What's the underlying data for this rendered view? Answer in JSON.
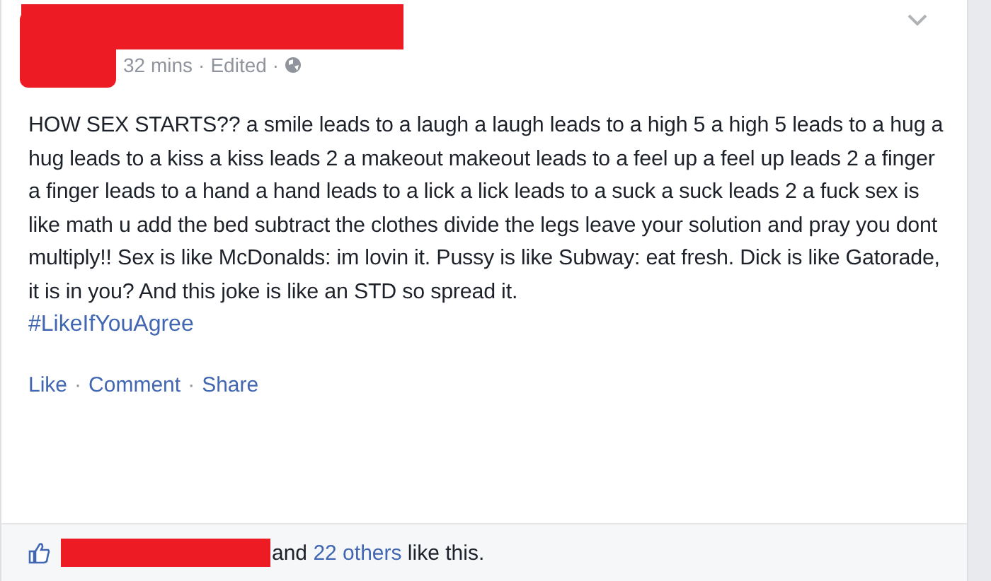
{
  "post": {
    "time": "32 mins",
    "edited": "Edited",
    "body": "HOW SEX STARTS?? a smile leads to a laugh a laugh leads to a high 5 a high 5 leads to a hug a hug leads to a kiss a kiss leads 2 a makeout makeout leads to a feel up a feel up leads 2 a finger a finger leads to a hand a hand leads to a lick a lick leads to a suck a suck leads 2 a fuck sex is like math u add the bed subtract the clothes divide the legs leave your solution and pray you dont multiply!! Sex is like McDonalds: im lovin it. Pussy is like Subway: eat fresh. Dick is like Gatorade, it is in you? And this joke is like an STD so spread it.",
    "hashtag": "#LikeIfYouAgree"
  },
  "separator": "·",
  "actions": [
    "Like",
    "Comment",
    "Share"
  ],
  "likes": {
    "before": "and",
    "others": "22 others",
    "after": "like this."
  }
}
